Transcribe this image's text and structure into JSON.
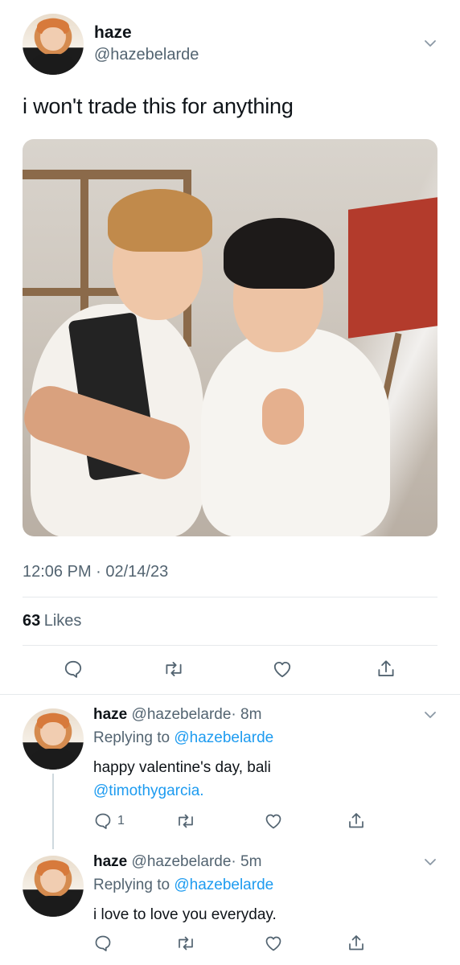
{
  "main_tweet": {
    "display_name": "haze",
    "handle": "@hazebelarde",
    "text": "i won't trade this for anything",
    "timestamp": "12:06 PM · 02/14/23",
    "likes_count": "63",
    "likes_label": "Likes",
    "menu_icon": "chevron-down-icon"
  },
  "actions": {
    "reply_icon": "reply-icon",
    "retweet_icon": "retweet-icon",
    "like_icon": "heart-icon",
    "share_icon": "share-icon"
  },
  "replies": [
    {
      "display_name": "haze",
      "handle": "@hazebelarde",
      "time": "· 8m",
      "replying_prefix": "Replying to",
      "replying_to": "@hazebelarde",
      "text": "happy valentine's day, bali",
      "mention": "@timothygarcia.",
      "reply_count": "1"
    },
    {
      "display_name": "haze",
      "handle": "@hazebelarde",
      "time": "· 5m",
      "replying_prefix": "Replying to",
      "replying_to": "@hazebelarde",
      "text": "i love to love you everyday.",
      "reply_count": ""
    }
  ],
  "colors": {
    "accent": "#1d9bf0",
    "text_primary": "#0f1419",
    "text_secondary": "#536471",
    "divider": "#e6e9ec"
  }
}
